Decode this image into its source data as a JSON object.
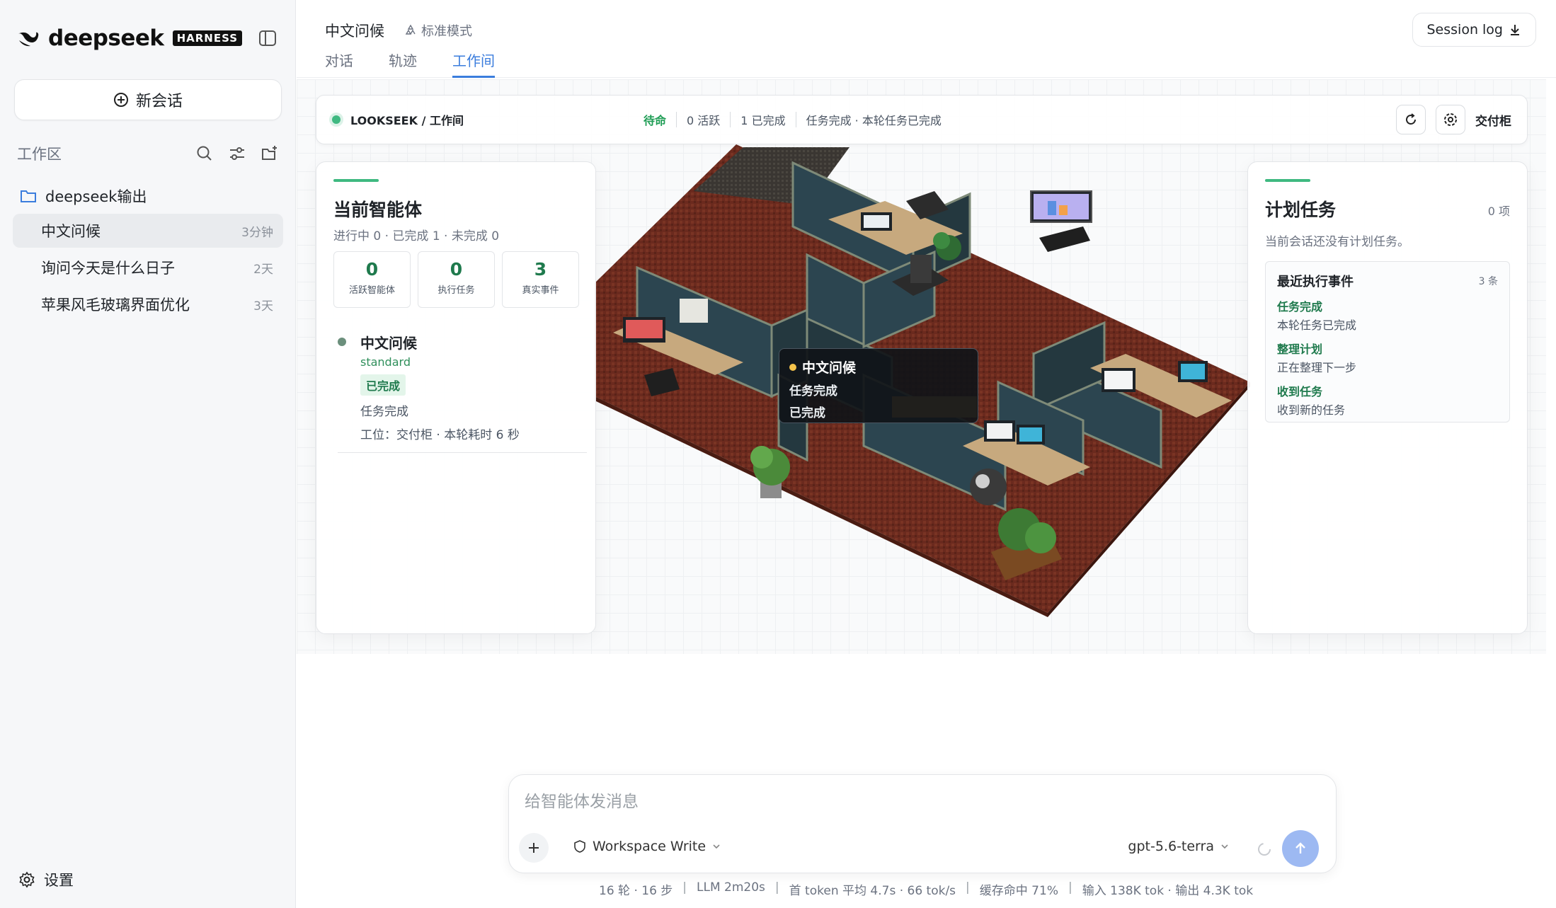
{
  "sidebar": {
    "brand": {
      "name": "deepseek",
      "badge": "HARNESS"
    },
    "new_chat": "新会话",
    "workspace_label": "工作区",
    "folder": "deepseek输出",
    "sessions": [
      {
        "title": "中文问候",
        "time": "3分钟"
      },
      {
        "title": "询问今天是什么日子",
        "time": "2天"
      },
      {
        "title": "苹果风毛玻璃界面优化",
        "time": "3天"
      }
    ],
    "settings": "设置"
  },
  "header": {
    "title": "中文问候",
    "mode": "标准模式",
    "tabs": [
      "对话",
      "轨迹",
      "工作间"
    ],
    "session_log": "Session log"
  },
  "statusbar": {
    "crumb": "LOOKSEEK / 工作间",
    "status": "待命",
    "active": "0 活跃",
    "done": "1 已完成",
    "task": "任务完成 · 本轮任务已完成",
    "locker": "交付柜"
  },
  "agents_panel": {
    "title": "当前智能体",
    "summary": "进行中 0 · 已完成 1 · 未完成 0",
    "metrics": [
      {
        "value": "0",
        "label": "活跃智能体"
      },
      {
        "value": "0",
        "label": "执行任务"
      },
      {
        "value": "3",
        "label": "真实事件"
      }
    ],
    "agent": {
      "name": "中文问候",
      "tier": "standard",
      "badge": "已完成",
      "status": "任务完成",
      "detail": "工位：交付柜 · 本轮耗时 6 秒"
    }
  },
  "tasks_panel": {
    "title": "计划任务",
    "count": "0 项",
    "empty": "当前会话还没有计划任务。",
    "events_title": "最近执行事件",
    "events_count": "3 条",
    "events": [
      {
        "title": "任务完成",
        "detail": "本轮任务已完成"
      },
      {
        "title": "整理计划",
        "detail": "正在整理下一步"
      },
      {
        "title": "收到任务",
        "detail": "收到新的任务"
      }
    ]
  },
  "tooltip": {
    "name": "中文问候",
    "line1": "任务完成",
    "line2": "已完成"
  },
  "composer": {
    "placeholder": "给智能体发消息",
    "workspace_write": "Workspace Write",
    "model": "gpt-5.6-terra"
  },
  "footer": {
    "turns": "16 轮 · 16 步",
    "llm": "LLM 2m20s",
    "first_token": "首 token 平均 4.7s · 66 tok/s",
    "cache": "缓存命中 71%",
    "tokens": "输入 138K tok · 输出 4.3K tok"
  },
  "colors": {
    "accent": "#3b7ddd",
    "success": "#1f9d55",
    "carpet": "#6b2a1e",
    "send": "#9db9f2"
  }
}
